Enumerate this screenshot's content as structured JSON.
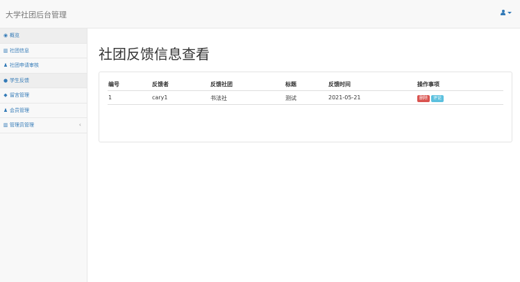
{
  "app": {
    "title": "大学社团后台管理"
  },
  "sidebar": {
    "items": [
      {
        "label": "概览",
        "icon": "dashboard-icon",
        "glyph": "◉",
        "active": true
      },
      {
        "label": "社团信息",
        "icon": "bar-chart-icon",
        "glyph": "▥",
        "active": false
      },
      {
        "label": "社团申请审核",
        "icon": "user-icon",
        "glyph": "♟",
        "active": false
      },
      {
        "label": "学生反馈",
        "icon": "info-icon",
        "glyph": "●",
        "active": true
      },
      {
        "label": "留言管理",
        "icon": "comment-icon",
        "glyph": "◆",
        "active": false
      },
      {
        "label": "会员管理",
        "icon": "user-icon",
        "glyph": "♟",
        "active": false
      },
      {
        "label": "管理员管理",
        "icon": "bar-chart-icon",
        "glyph": "▥",
        "active": false,
        "arrow": "‹"
      }
    ]
  },
  "main": {
    "title": "社团反馈信息查看",
    "table": {
      "headers": [
        "编号",
        "反馈者",
        "反馈社团",
        "标题",
        "反馈时间",
        "操作事项"
      ],
      "rows": [
        {
          "id": "1",
          "user": "cary1",
          "club": "书法社",
          "subject": "测试",
          "time": "2021-05-21",
          "actions": {
            "delete": "删除",
            "review": "评论"
          }
        }
      ]
    }
  },
  "colors": {
    "link": "#337ab7",
    "danger": "#d9534f",
    "info": "#5bc0de"
  }
}
